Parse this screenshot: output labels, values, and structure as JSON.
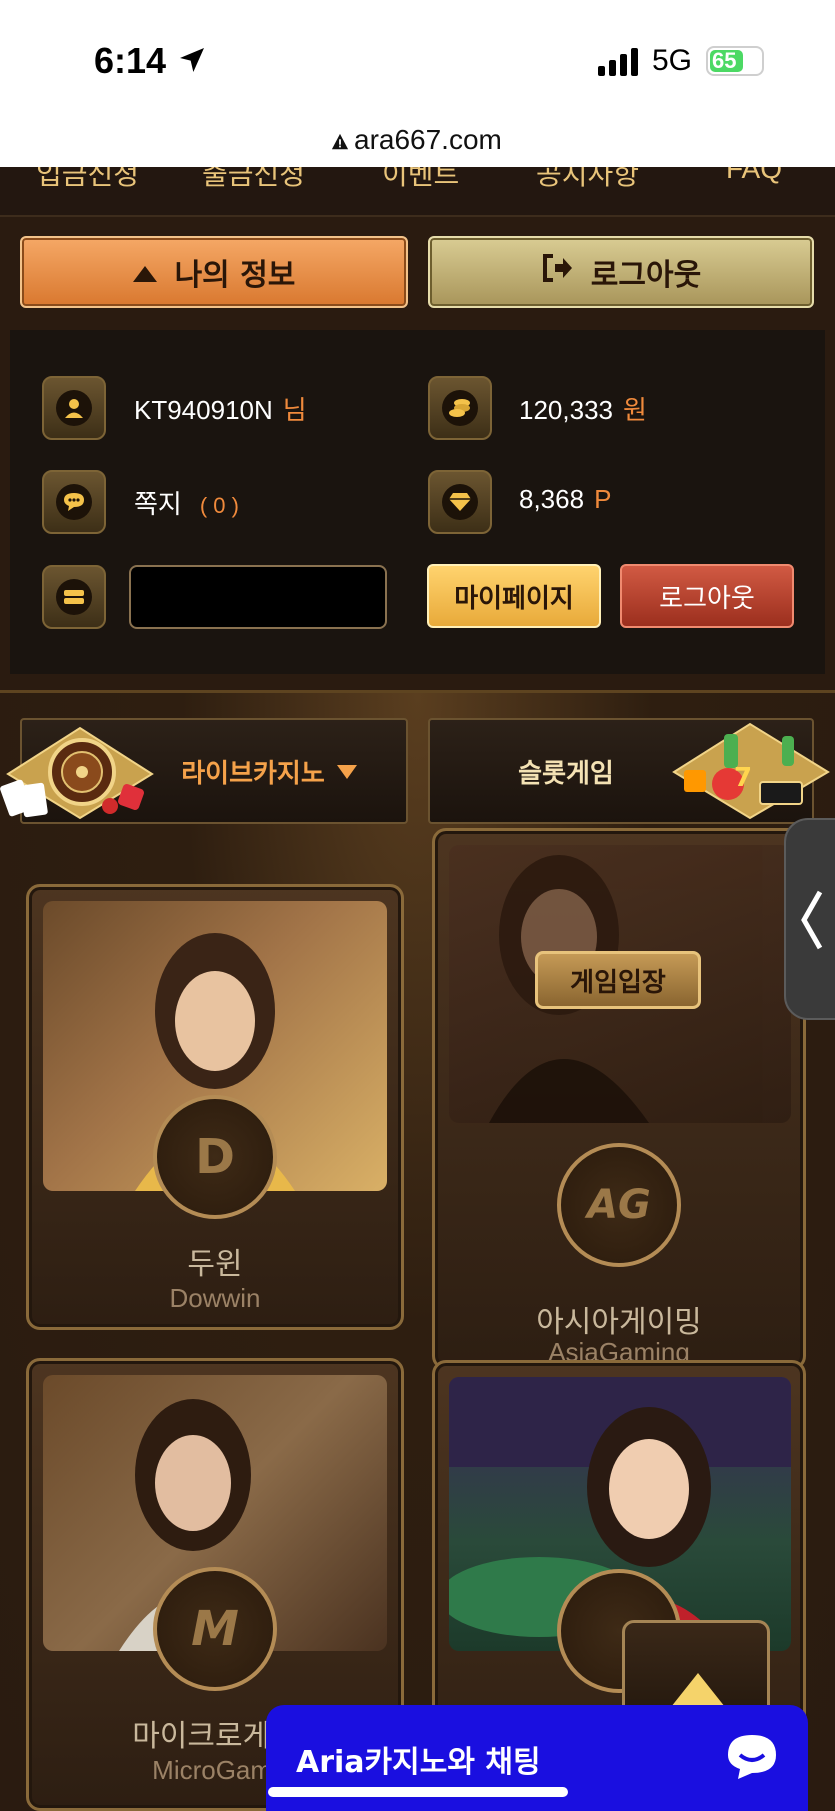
{
  "status_bar": {
    "time": "6:14",
    "network": "5G",
    "battery": "65",
    "battery_level": 0.65
  },
  "browser": {
    "url": "ara667.com"
  },
  "top_nav": {
    "items": [
      "입금신청",
      "출금신청",
      "이벤트",
      "공지사항",
      "FAQ"
    ]
  },
  "account": {
    "my_info_label": "나의 정보",
    "logout_label": "로그아웃",
    "username": "KT940910N",
    "username_suffix": "님",
    "balance": "120,333",
    "balance_unit": "원",
    "memo_label": "쪽지",
    "memo_count": "( 0 )",
    "points": "8,368",
    "points_unit": "P",
    "mypage_label": "마이페이지",
    "logout_small_label": "로그아웃"
  },
  "categories": {
    "live_casino": "라이브카지노",
    "slot": "슬롯게임"
  },
  "games": [
    {
      "name_ko": "두윈",
      "name_en": "Dowwin",
      "logo": "D"
    },
    {
      "name_ko": "아시아게이밍",
      "name_en": "AsiaGaming",
      "logo": "AG",
      "enter_label": "게임입장"
    },
    {
      "name_ko": "마이크로게이",
      "name_en": "MicroGami",
      "logo": "M"
    },
    {
      "name_ko": "",
      "name_en": "",
      "logo": ""
    }
  ],
  "chat": {
    "label": "Aria카지노와 채팅"
  },
  "colors": {
    "accent_orange": "#f08a3c",
    "gold": "#e8aa3a",
    "chat_blue": "#1a0fe0"
  }
}
